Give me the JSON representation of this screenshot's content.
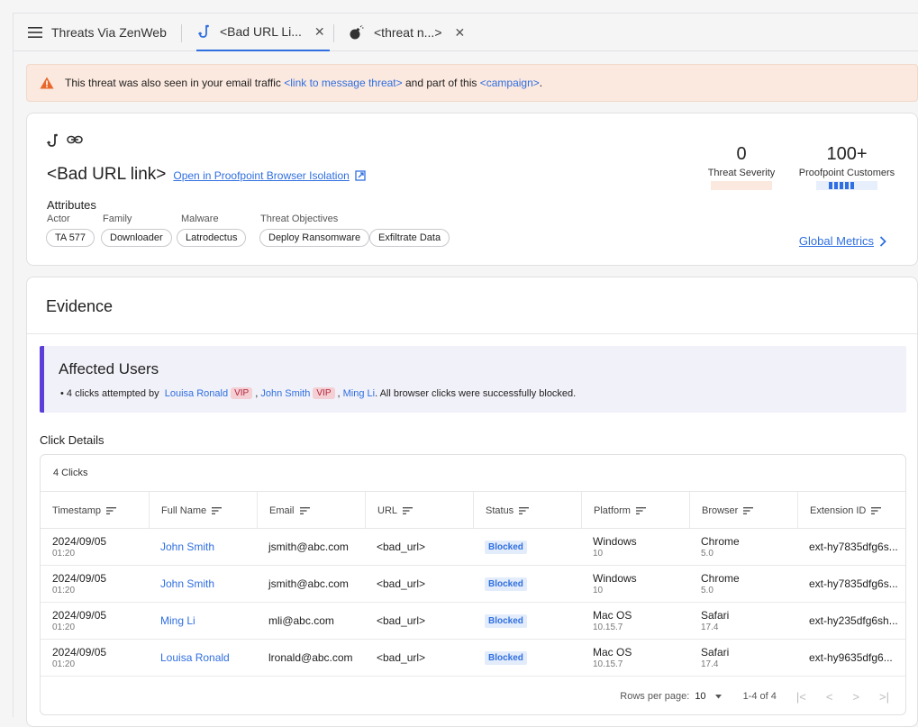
{
  "tabs": {
    "main_label": "Threats Via ZenWeb",
    "tab1_label": "<Bad URL Li...",
    "tab2_label": "<threat n...>",
    "close_symbol": "✕"
  },
  "banner": {
    "text_before": "This threat was also seen in your email traffic",
    "link1": "<link to message threat>",
    "text_mid": "and part of this",
    "link2": "<campaign>",
    "text_end": "."
  },
  "threat": {
    "title": "<Bad URL link>",
    "open_link": "Open in Proofpoint Browser Isolation",
    "attributes_heading": "Attributes",
    "labels": {
      "actor": "Actor",
      "family": "Family",
      "malware": "Malware",
      "objectives": "Threat Objectives"
    },
    "chips": {
      "actor": "TA 577",
      "family": "Downloader",
      "malware": "Latrodectus",
      "objective1": "Deploy Ransomware",
      "objective2": "Exfiltrate Data"
    },
    "severity": {
      "value": "0",
      "label": "Threat Severity"
    },
    "customers": {
      "value": "100+",
      "label": "Proofpoint Customers",
      "level": 0.5
    },
    "global_metrics": "Global Metrics"
  },
  "evidence": {
    "title": "Evidence",
    "affected": {
      "heading": "Affected Users",
      "prefix": "• 4 clicks attempted by",
      "user1": "Louisa Ronald",
      "user2": "John Smith",
      "user3": "Ming Li",
      "vip": "VIP",
      "comma": ",",
      "suffix": ". All browser clicks were successfully blocked."
    },
    "click_details": "Click Details",
    "count": "4 Clicks",
    "columns": [
      "Timestamp",
      "Full Name",
      "Email",
      "URL",
      "Status",
      "Platform",
      "Browser",
      "Extension ID"
    ],
    "rows": [
      {
        "date": "2024/09/05",
        "time": "01:20",
        "name": "John Smith",
        "email": "jsmith@abc.com",
        "url": "<bad_url>",
        "status": "Blocked",
        "platform": "Windows",
        "platform_ver": "10",
        "browser": "Chrome",
        "browser_ver": "5.0",
        "ext": "ext-hy7835dfg6s..."
      },
      {
        "date": "2024/09/05",
        "time": "01:20",
        "name": "John Smith",
        "email": "jsmith@abc.com",
        "url": "<bad_url>",
        "status": "Blocked",
        "platform": "Windows",
        "platform_ver": "10",
        "browser": "Chrome",
        "browser_ver": "5.0",
        "ext": "ext-hy7835dfg6s..."
      },
      {
        "date": "2024/09/05",
        "time": "01:20",
        "name": "Ming Li",
        "email": "mli@abc.com",
        "url": "<bad_url>",
        "status": "Blocked",
        "platform": "Mac OS",
        "platform_ver": "10.15.7",
        "browser": "Safari",
        "browser_ver": "17.4",
        "ext": "ext-hy235dfg6sh..."
      },
      {
        "date": "2024/09/05",
        "time": "01:20",
        "name": "Louisa Ronald",
        "email": "lronald@abc.com",
        "url": "<bad_url>",
        "status": "Blocked",
        "platform": "Mac OS",
        "platform_ver": "10.15.7",
        "browser": "Safari",
        "browser_ver": "17.4",
        "ext": "ext-hy9635dfg6..."
      }
    ],
    "pager": {
      "rows_label": "Rows per page:",
      "rows_value": "10",
      "range": "1-4 of 4"
    }
  }
}
